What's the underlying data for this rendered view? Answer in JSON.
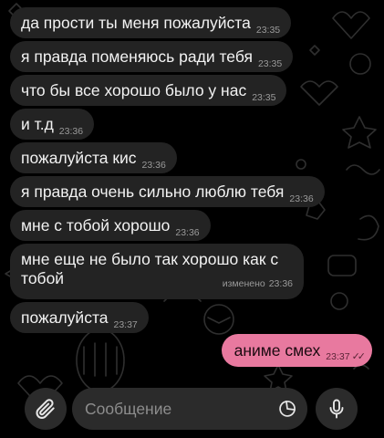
{
  "messages": [
    {
      "text": "да прости ты меня пожалуйста",
      "time": "23:35"
    },
    {
      "text": "я правда поменяюсь ради тебя",
      "time": "23:35"
    },
    {
      "text": "что бы все хорошо было у нас",
      "time": "23:35"
    },
    {
      "text": "и т.д",
      "time": "23:36"
    },
    {
      "text": "пожалуйста кис",
      "time": "23:36"
    },
    {
      "text": "я правда очень сильно люблю тебя",
      "time": "23:36"
    },
    {
      "text": "мне с тобой хорошо",
      "time": "23:36"
    },
    {
      "text": "мне еще не было так хорошо как с тобой",
      "time": "23:36",
      "edited": "изменено"
    },
    {
      "text": "пожалуйста",
      "time": "23:37"
    }
  ],
  "outgoing": {
    "text": "аниме смех",
    "time": "23:37",
    "status_icon": "double-check-icon"
  },
  "composer": {
    "placeholder": "Сообщение",
    "attach_icon": "paperclip-icon",
    "sticker_icon": "sticker-icon",
    "mic_icon": "microphone-icon"
  },
  "colors": {
    "background": "#000000",
    "incoming_bubble": "#232323",
    "outgoing_bubble": "#e8799f",
    "input_bg": "#2b2b2b"
  }
}
